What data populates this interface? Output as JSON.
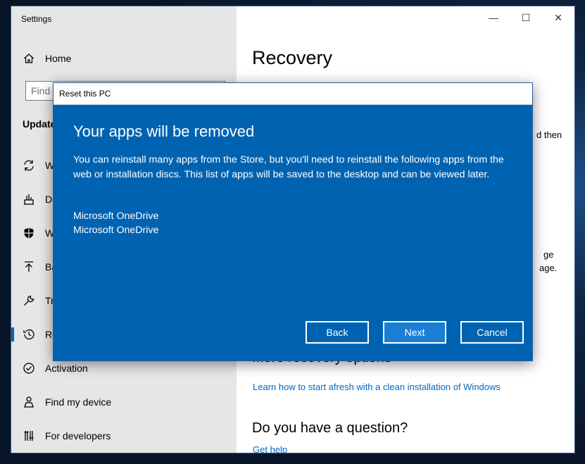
{
  "window": {
    "app_title": "Settings",
    "controls": {
      "minimize": "—",
      "maximize": "☐",
      "close": "✕"
    }
  },
  "sidebar": {
    "home_label": "Home",
    "search_placeholder": "Find",
    "section_heading": "Update",
    "items": [
      {
        "label": "W",
        "icon": "sync-icon"
      },
      {
        "label": "De",
        "icon": "delivery-icon"
      },
      {
        "label": "W",
        "icon": "shield-icon"
      },
      {
        "label": "Ba",
        "icon": "backup-arrow-icon"
      },
      {
        "label": "Tr",
        "icon": "wrench-icon"
      },
      {
        "label": "Re",
        "icon": "history-icon",
        "selected": true
      },
      {
        "label": "Activation",
        "icon": "check-circle-icon"
      },
      {
        "label": "Find my device",
        "icon": "person-pin-icon"
      },
      {
        "label": "For developers",
        "icon": "developer-tools-icon"
      }
    ]
  },
  "content": {
    "page_title": "Recovery",
    "clipped_text_1": "d then",
    "clipped_text_2": "ge",
    "clipped_text_3": "age.",
    "more_heading": "More recovery options",
    "clean_install_link": "Learn how to start afresh with a clean installation of Windows",
    "question_heading": "Do you have a question?",
    "get_help_link": "Get help"
  },
  "dialog": {
    "title": "Reset this PC",
    "heading": "Your apps will be removed",
    "body": "You can reinstall many apps from the Store, but you'll need to reinstall the following apps from the web or installation discs. This list of apps will be saved to the desktop and can be viewed later.",
    "apps": [
      "Microsoft OneDrive",
      "Microsoft OneDrive"
    ],
    "buttons": {
      "back": "Back",
      "next": "Next",
      "cancel": "Cancel"
    }
  }
}
